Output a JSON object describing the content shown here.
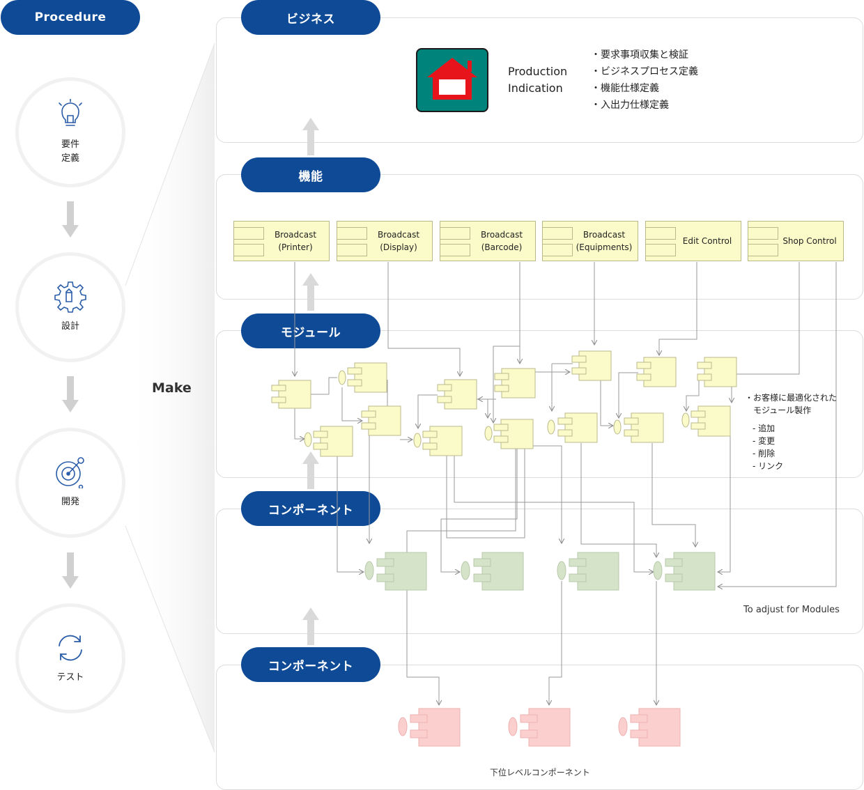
{
  "procedure": {
    "title": "Procedure",
    "steps": [
      {
        "label": "要件\n定義",
        "icon": "lightbulb-icon"
      },
      {
        "label": "設計",
        "icon": "gear-pencil-icon"
      },
      {
        "label": "開発",
        "icon": "target-dev-icon"
      },
      {
        "label": "テスト",
        "icon": "refresh-icon"
      }
    ],
    "make_label": "Make"
  },
  "layers": {
    "business": {
      "title": "ビジネス",
      "production": "Production\nIndication",
      "bullets": [
        "・要求事項収集と検証",
        "・ビジネスプロセス定義",
        "・機能仕様定義",
        "・入出力仕様定義"
      ],
      "house_icon": "house-icon"
    },
    "function": {
      "title": "機能",
      "modules": [
        "Broadcast\n(Printer)",
        "Broadcast\n(Display)",
        "Broadcast\n(Barcode)",
        "Broadcast\n(Equipments)",
        "Edit Control",
        "Shop Control"
      ]
    },
    "module": {
      "title": "モジュール",
      "note_title": "・お客様に最適化された\n　モジュール製作",
      "note_items": [
        "- 追加",
        "- 変更",
        "- 削除",
        "- リンク"
      ]
    },
    "component": {
      "title": "コンポーネント",
      "note": "To adjust for Modules"
    },
    "sub_component": {
      "title": "コンポーネント",
      "note": "下位レベルコンポーネント"
    }
  },
  "colors": {
    "pill": "#0e4a96",
    "module_fill": "#fbfbc9",
    "component_fill": "#d5e3c9",
    "sub_component_fill": "#fccfcf",
    "house_bg": "#00837b",
    "house_roof": "#e8141b"
  }
}
